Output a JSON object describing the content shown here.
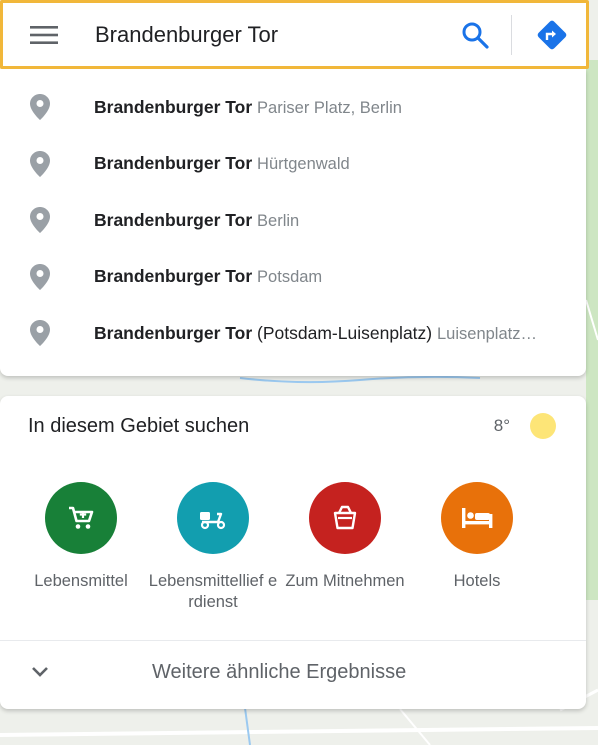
{
  "search": {
    "value": "Brandenburger Tor",
    "menu_icon": "hamburger-menu-icon",
    "search_icon": "magnifier-icon",
    "directions_icon": "directions-icon"
  },
  "suggestions": [
    {
      "main": "Brandenburger Tor",
      "extra": "",
      "sub": "Pariser Platz, Berlin"
    },
    {
      "main": "Brandenburger Tor",
      "extra": "",
      "sub": "Hürtgenwald"
    },
    {
      "main": "Brandenburger Tor",
      "extra": "",
      "sub": "Berlin"
    },
    {
      "main": "Brandenburger Tor",
      "extra": "",
      "sub": "Potsdam"
    },
    {
      "main": "Brandenburger Tor",
      "extra": " (Potsdam-Luisenplatz)",
      "sub": "Luisenplatz…"
    }
  ],
  "area": {
    "title": "In diesem Gebiet suchen",
    "temperature": "8°",
    "weather_icon": "sun-icon",
    "categories": [
      {
        "label": "Lebensmittel",
        "icon": "shopping-cart-icon",
        "color": "#188038"
      },
      {
        "label": "Lebensmittellief erdienst",
        "icon": "delivery-scooter-icon",
        "color": "#129eaf"
      },
      {
        "label": "Zum Mitnehmen",
        "icon": "takeout-box-icon",
        "color": "#c5221f"
      },
      {
        "label": "Hotels",
        "icon": "bed-icon",
        "color": "#e8710a"
      }
    ],
    "more_label": "Weitere ähnliche Ergebnisse"
  },
  "colors": {
    "accent_blue": "#1a73e8",
    "search_border": "#f1b73a",
    "pin_gray": "#9aa0a6"
  }
}
